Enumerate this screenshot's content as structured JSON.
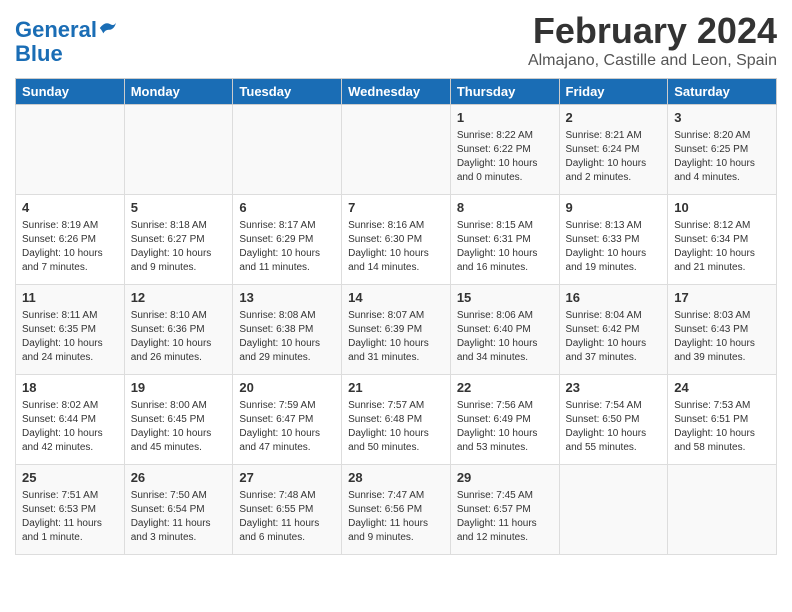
{
  "header": {
    "logo_line1": "General",
    "logo_line2": "Blue",
    "month": "February 2024",
    "location": "Almajano, Castille and Leon, Spain"
  },
  "days_of_week": [
    "Sunday",
    "Monday",
    "Tuesday",
    "Wednesday",
    "Thursday",
    "Friday",
    "Saturday"
  ],
  "weeks": [
    [
      {
        "num": "",
        "info": ""
      },
      {
        "num": "",
        "info": ""
      },
      {
        "num": "",
        "info": ""
      },
      {
        "num": "",
        "info": ""
      },
      {
        "num": "1",
        "info": "Sunrise: 8:22 AM\nSunset: 6:22 PM\nDaylight: 10 hours\nand 0 minutes."
      },
      {
        "num": "2",
        "info": "Sunrise: 8:21 AM\nSunset: 6:24 PM\nDaylight: 10 hours\nand 2 minutes."
      },
      {
        "num": "3",
        "info": "Sunrise: 8:20 AM\nSunset: 6:25 PM\nDaylight: 10 hours\nand 4 minutes."
      }
    ],
    [
      {
        "num": "4",
        "info": "Sunrise: 8:19 AM\nSunset: 6:26 PM\nDaylight: 10 hours\nand 7 minutes."
      },
      {
        "num": "5",
        "info": "Sunrise: 8:18 AM\nSunset: 6:27 PM\nDaylight: 10 hours\nand 9 minutes."
      },
      {
        "num": "6",
        "info": "Sunrise: 8:17 AM\nSunset: 6:29 PM\nDaylight: 10 hours\nand 11 minutes."
      },
      {
        "num": "7",
        "info": "Sunrise: 8:16 AM\nSunset: 6:30 PM\nDaylight: 10 hours\nand 14 minutes."
      },
      {
        "num": "8",
        "info": "Sunrise: 8:15 AM\nSunset: 6:31 PM\nDaylight: 10 hours\nand 16 minutes."
      },
      {
        "num": "9",
        "info": "Sunrise: 8:13 AM\nSunset: 6:33 PM\nDaylight: 10 hours\nand 19 minutes."
      },
      {
        "num": "10",
        "info": "Sunrise: 8:12 AM\nSunset: 6:34 PM\nDaylight: 10 hours\nand 21 minutes."
      }
    ],
    [
      {
        "num": "11",
        "info": "Sunrise: 8:11 AM\nSunset: 6:35 PM\nDaylight: 10 hours\nand 24 minutes."
      },
      {
        "num": "12",
        "info": "Sunrise: 8:10 AM\nSunset: 6:36 PM\nDaylight: 10 hours\nand 26 minutes."
      },
      {
        "num": "13",
        "info": "Sunrise: 8:08 AM\nSunset: 6:38 PM\nDaylight: 10 hours\nand 29 minutes."
      },
      {
        "num": "14",
        "info": "Sunrise: 8:07 AM\nSunset: 6:39 PM\nDaylight: 10 hours\nand 31 minutes."
      },
      {
        "num": "15",
        "info": "Sunrise: 8:06 AM\nSunset: 6:40 PM\nDaylight: 10 hours\nand 34 minutes."
      },
      {
        "num": "16",
        "info": "Sunrise: 8:04 AM\nSunset: 6:42 PM\nDaylight: 10 hours\nand 37 minutes."
      },
      {
        "num": "17",
        "info": "Sunrise: 8:03 AM\nSunset: 6:43 PM\nDaylight: 10 hours\nand 39 minutes."
      }
    ],
    [
      {
        "num": "18",
        "info": "Sunrise: 8:02 AM\nSunset: 6:44 PM\nDaylight: 10 hours\nand 42 minutes."
      },
      {
        "num": "19",
        "info": "Sunrise: 8:00 AM\nSunset: 6:45 PM\nDaylight: 10 hours\nand 45 minutes."
      },
      {
        "num": "20",
        "info": "Sunrise: 7:59 AM\nSunset: 6:47 PM\nDaylight: 10 hours\nand 47 minutes."
      },
      {
        "num": "21",
        "info": "Sunrise: 7:57 AM\nSunset: 6:48 PM\nDaylight: 10 hours\nand 50 minutes."
      },
      {
        "num": "22",
        "info": "Sunrise: 7:56 AM\nSunset: 6:49 PM\nDaylight: 10 hours\nand 53 minutes."
      },
      {
        "num": "23",
        "info": "Sunrise: 7:54 AM\nSunset: 6:50 PM\nDaylight: 10 hours\nand 55 minutes."
      },
      {
        "num": "24",
        "info": "Sunrise: 7:53 AM\nSunset: 6:51 PM\nDaylight: 10 hours\nand 58 minutes."
      }
    ],
    [
      {
        "num": "25",
        "info": "Sunrise: 7:51 AM\nSunset: 6:53 PM\nDaylight: 11 hours\nand 1 minute."
      },
      {
        "num": "26",
        "info": "Sunrise: 7:50 AM\nSunset: 6:54 PM\nDaylight: 11 hours\nand 3 minutes."
      },
      {
        "num": "27",
        "info": "Sunrise: 7:48 AM\nSunset: 6:55 PM\nDaylight: 11 hours\nand 6 minutes."
      },
      {
        "num": "28",
        "info": "Sunrise: 7:47 AM\nSunset: 6:56 PM\nDaylight: 11 hours\nand 9 minutes."
      },
      {
        "num": "29",
        "info": "Sunrise: 7:45 AM\nSunset: 6:57 PM\nDaylight: 11 hours\nand 12 minutes."
      },
      {
        "num": "",
        "info": ""
      },
      {
        "num": "",
        "info": ""
      }
    ]
  ]
}
